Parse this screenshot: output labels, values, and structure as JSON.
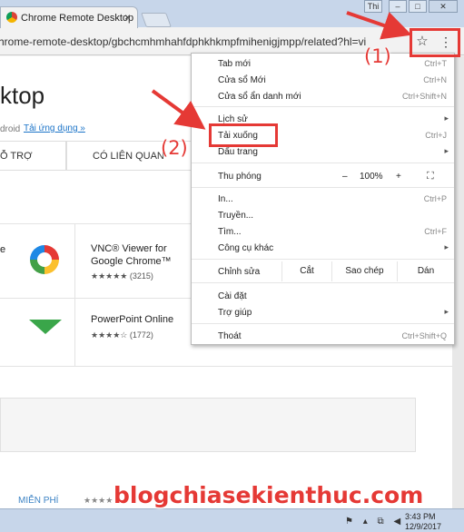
{
  "window": {
    "tab_title": "Chrome Remote Desktop",
    "tab_close": "×",
    "user_btn": "Thi",
    "min_btn": "–",
    "max_btn": "□",
    "close_btn": "✕"
  },
  "address_bar": {
    "url": "hrome-remote-desktop/gbchcmhmhahfdphkhkmpfmihenigjmpp/related?hl=vi",
    "star_icon": "☆",
    "menu_icon": "⋮"
  },
  "page": {
    "title": "ktop",
    "platform": "droid",
    "compat_link": "Tải ứng dụng »",
    "tab_support": "Ỗ TRỢ",
    "tab_related": "CÓ LIÊN QUAN",
    "row1_left": "e",
    "app1_name_line1": "VNC® Viewer for",
    "app1_name_line2": "Google Chrome™",
    "app1_rating": "★★★★★ (3215)",
    "app2_name": "PowerPoint Online",
    "app2_rating": "★★★★☆ (1772)",
    "free_label": "MIỄN PHÍ",
    "bottom_rating": "★★★★"
  },
  "menu": {
    "new_tab": {
      "label": "Tab mới",
      "shortcut": "Ctrl+T"
    },
    "new_window": {
      "label": "Cửa sổ Mới",
      "shortcut": "Ctrl+N"
    },
    "incognito": {
      "label": "Cửa sổ ẩn danh mới",
      "shortcut": "Ctrl+Shift+N"
    },
    "history": {
      "label": "Lịch sử",
      "arrow": "▸"
    },
    "downloads": {
      "label": "Tải xuống",
      "shortcut": "Ctrl+J"
    },
    "bookmarks": {
      "label": "Dấu trang",
      "arrow": "▸"
    },
    "zoom": {
      "label": "Thu phóng",
      "minus": "–",
      "value": "100%",
      "plus": "+",
      "fullscreen": "⛶"
    },
    "print": {
      "label": "In...",
      "shortcut": "Ctrl+P"
    },
    "cast": {
      "label": "Truyền..."
    },
    "find": {
      "label": "Tìm...",
      "shortcut": "Ctrl+F"
    },
    "more_tools": {
      "label": "Công cụ khác",
      "arrow": "▸"
    },
    "edit": {
      "label": "Chỉnh sửa",
      "cut": "Cắt",
      "copy": "Sao chép",
      "paste": "Dán"
    },
    "settings": {
      "label": "Cài đặt"
    },
    "help": {
      "label": "Trợ giúp",
      "arrow": "▸"
    },
    "exit": {
      "label": "Thoát",
      "shortcut": "Ctrl+Shift+Q"
    }
  },
  "annotations": {
    "step1": "(1)",
    "step2": "(2)",
    "brand": "blogchiasekienthuc.com"
  },
  "taskbar": {
    "time": "3:43 PM",
    "date": "12/9/2017",
    "tray": "⚑ ▴ ⧉ ◀"
  }
}
